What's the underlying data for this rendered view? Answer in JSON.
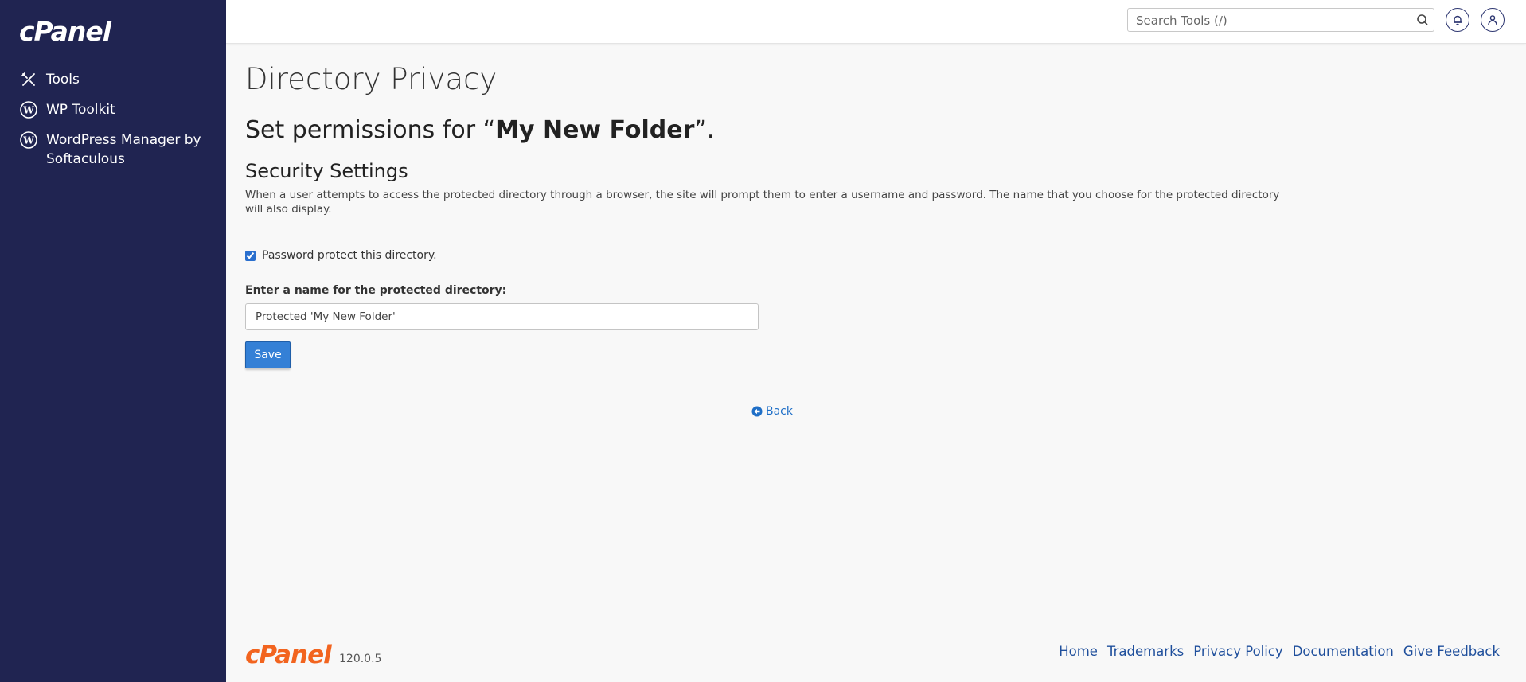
{
  "brand": {
    "name": "cPanel",
    "footer_version": "120.0.5",
    "accent": "#f2641f",
    "sidebar_bg": "#202451"
  },
  "sidebar": {
    "items": [
      {
        "label": "Tools",
        "icon": "tools-icon"
      },
      {
        "label": "WP Toolkit",
        "icon": "wordpress-icon"
      },
      {
        "label": "WordPress Manager by Softaculous",
        "icon": "wordpress-icon"
      }
    ]
  },
  "header": {
    "search_placeholder": "Search Tools (/)",
    "search_icon": "search-icon",
    "notifications_icon": "bell-icon",
    "user_icon": "user-icon"
  },
  "main": {
    "page_title": "Directory Privacy",
    "perm_prefix": "Set permissions for “",
    "folder_name": "My New Folder",
    "perm_suffix": "”.",
    "section_title": "Security Settings",
    "description": "When a user attempts to access the protected directory through a browser, the site will prompt them to enter a username and password. The name that you choose for the protected directory will also display.",
    "checkbox_label": "Password protect this directory.",
    "checkbox_checked": true,
    "name_label": "Enter a name for the protected directory:",
    "name_value": "Protected 'My New Folder'",
    "save_label": "Save",
    "back_label": "Back",
    "back_icon": "arrow-circle-left-icon"
  },
  "footer": {
    "links": [
      "Home",
      "Trademarks",
      "Privacy Policy",
      "Documentation",
      "Give Feedback"
    ]
  }
}
